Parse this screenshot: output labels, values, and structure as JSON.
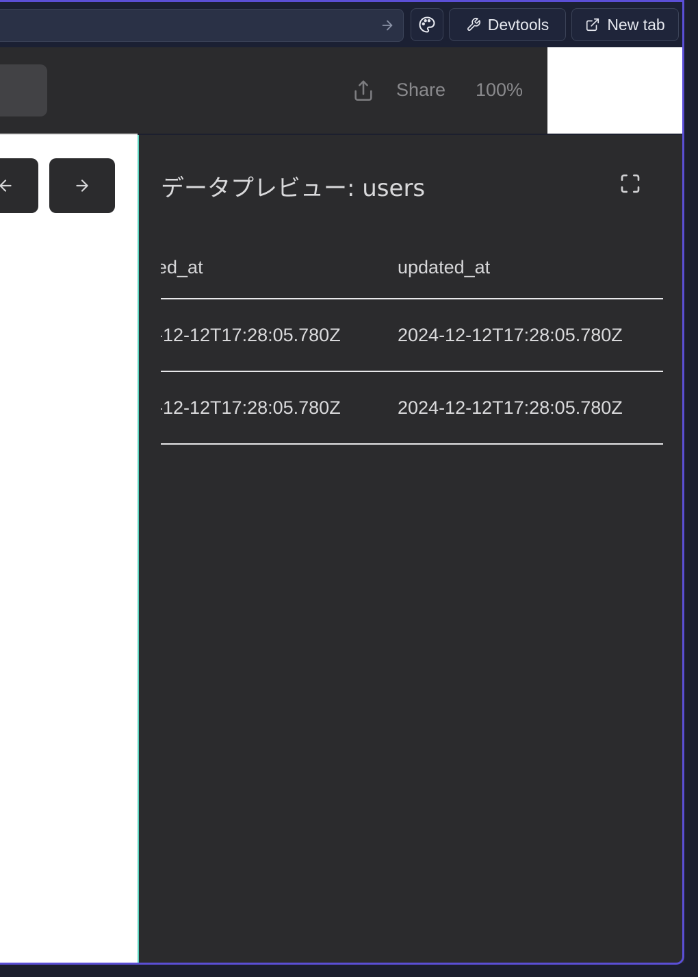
{
  "toolbar": {
    "devtools_label": "Devtools",
    "newtab_label": "New tab"
  },
  "header": {
    "share_label": "Share",
    "zoom_label": "100%"
  },
  "preview": {
    "title": "データプレビュー: users",
    "columns": [
      "ed_at",
      "updated_at"
    ],
    "rows": [
      [
        "-12-12T17:28:05.780Z",
        "2024-12-12T17:28:05.780Z"
      ],
      [
        "-12-12T17:28:05.780Z",
        "2024-12-12T17:28:05.780Z"
      ]
    ]
  },
  "colors": {
    "accent_border": "#5b4fd6",
    "pane_divider": "#5cd4c0",
    "dark_panel": "#2b2b2d"
  }
}
